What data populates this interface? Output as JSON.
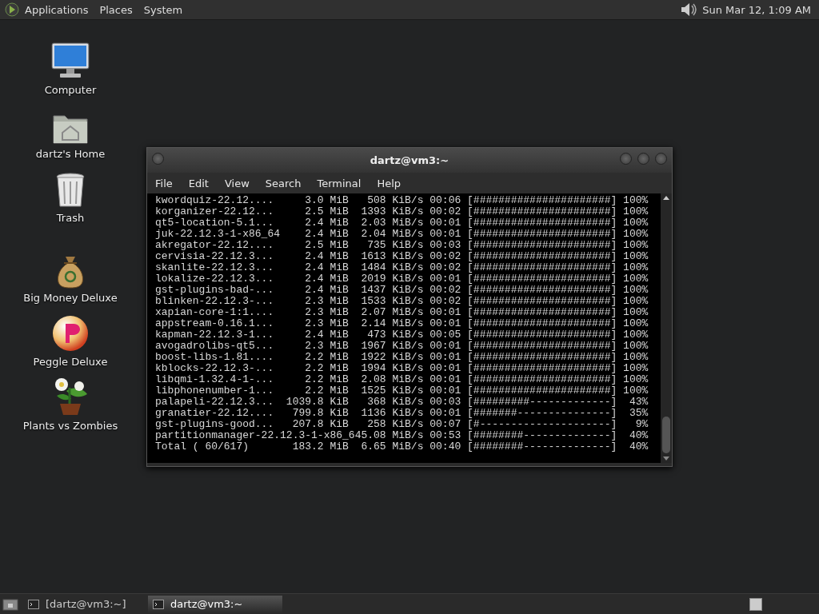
{
  "top_panel": {
    "menus": [
      "Applications",
      "Places",
      "System"
    ],
    "clock": "Sun Mar 12, 1:09 AM"
  },
  "desktop_icons": [
    {
      "kind": "computer",
      "label": "Computer"
    },
    {
      "kind": "home",
      "label": "dartz's Home"
    },
    {
      "kind": "trash",
      "label": "Trash"
    },
    {
      "kind": "moneybag",
      "label": "Big Money Deluxe"
    },
    {
      "kind": "peggle",
      "label": "Peggle Deluxe"
    },
    {
      "kind": "plant",
      "label": "Plants vs Zombies"
    }
  ],
  "terminal": {
    "title": "dartz@vm3:~",
    "menu": [
      "File",
      "Edit",
      "View",
      "Search",
      "Terminal",
      "Help"
    ],
    "lines": [
      "kwordquiz-22.12....     3.0 MiB   508 KiB/s 00:06 [######################] 100%",
      "korganizer-22.12...     2.5 MiB  1393 KiB/s 00:02 [######################] 100%",
      "qt5-location-5.1...     2.4 MiB  2.03 MiB/s 00:01 [######################] 100%",
      "juk-22.12.3-1-x86_64    2.4 MiB  2.04 MiB/s 00:01 [######################] 100%",
      "akregator-22.12....     2.5 MiB   735 KiB/s 00:03 [######################] 100%",
      "cervisia-22.12.3...     2.4 MiB  1613 KiB/s 00:02 [######################] 100%",
      "skanlite-22.12.3...     2.4 MiB  1484 KiB/s 00:02 [######################] 100%",
      "lokalize-22.12.3...     2.4 MiB  2019 KiB/s 00:01 [######################] 100%",
      "gst-plugins-bad-...     2.4 MiB  1437 KiB/s 00:02 [######################] 100%",
      "blinken-22.12.3-...     2.3 MiB  1533 KiB/s 00:02 [######################] 100%",
      "xapian-core-1:1....     2.3 MiB  2.07 MiB/s 00:01 [######################] 100%",
      "appstream-0.16.1...     2.3 MiB  2.14 MiB/s 00:01 [######################] 100%",
      "kapman-22.12.3-1...     2.4 MiB   473 KiB/s 00:05 [######################] 100%",
      "avogadrolibs-qt5...     2.3 MiB  1967 KiB/s 00:01 [######################] 100%",
      "boost-libs-1.81....     2.2 MiB  1922 KiB/s 00:01 [######################] 100%",
      "kblocks-22.12.3-...     2.2 MiB  1994 KiB/s 00:01 [######################] 100%",
      "libqmi-1.32.4-1-...     2.2 MiB  2.08 MiB/s 00:01 [######################] 100%",
      "libphonenumber-1...     2.2 MiB  1525 KiB/s 00:01 [######################] 100%",
      "palapeli-22.12.3...  1039.8 KiB   368 KiB/s 00:03 [#########-------------]  43%",
      "granatier-22.12....   799.8 KiB  1136 KiB/s 00:01 [#######---------------]  35%",
      "gst-plugins-good...   207.8 KiB   258 KiB/s 00:07 [#---------------------]   9%",
      "partitionmanager-22.12.3-1-x86_645.08 MiB/s 00:53 [########--------------]  40%",
      "Total ( 60/617)       183.2 MiB  6.65 MiB/s 00:40 [########--------------]  40%"
    ]
  },
  "taskbar": {
    "items": [
      {
        "label": "[dartz@vm3:~]",
        "selected": false
      },
      {
        "label": "dartz@vm3:~",
        "selected": true
      }
    ]
  }
}
